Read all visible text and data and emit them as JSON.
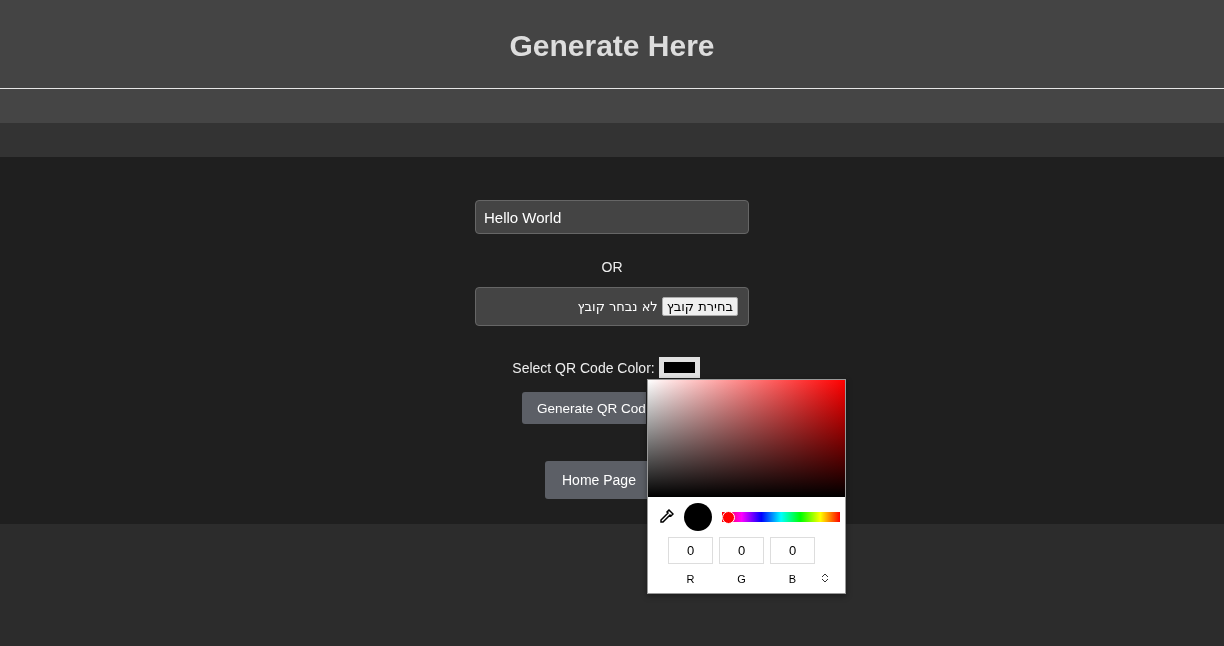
{
  "header": {
    "title": "Generate Here"
  },
  "form": {
    "text_input": {
      "value": "Hello World"
    },
    "separator": "OR",
    "file_input": {
      "button": "בחירת קובץ",
      "status": "לא נבחר קובץ"
    },
    "color_label": "Select QR Code Color:",
    "generate_button": "Generate QR Cod",
    "home_button": "Home Page"
  },
  "color_picker": {
    "hue": {
      "level": 0
    },
    "channels": [
      {
        "label": "R",
        "value": "0"
      },
      {
        "label": "G",
        "value": "0"
      },
      {
        "label": "B",
        "value": "0"
      }
    ]
  }
}
